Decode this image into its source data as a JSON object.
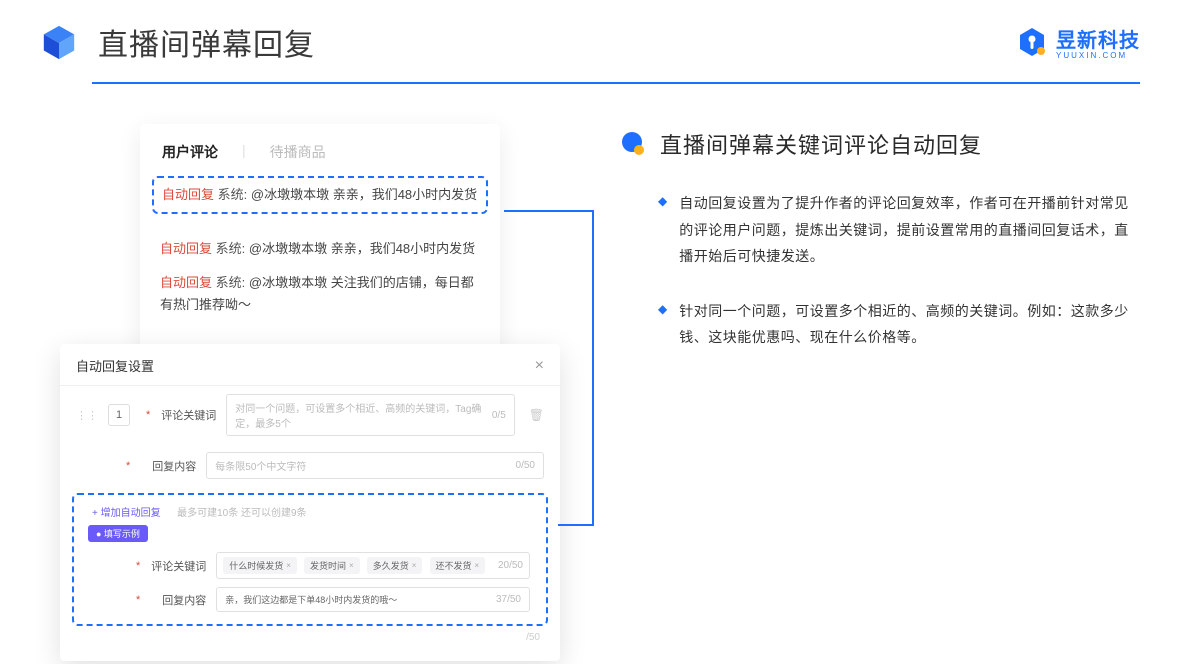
{
  "header": {
    "title": "直播间弹幕回复",
    "brand": "昱新科技",
    "brand_sub": "YUUXIN.COM"
  },
  "comments_panel": {
    "tab_active": "用户评论",
    "tab_inactive": "待播商品",
    "rows": [
      {
        "badge": "自动回复",
        "sys": "系统:",
        "text": "@冰墩墩本墩 亲亲，我们48小时内发货"
      },
      {
        "badge": "自动回复",
        "sys": "系统:",
        "text": "@冰墩墩本墩 亲亲，我们48小时内发货"
      },
      {
        "badge": "自动回复",
        "sys": "系统:",
        "text": "@冰墩墩本墩 关注我们的店铺，每日都有热门推荐呦～"
      }
    ]
  },
  "settings_panel": {
    "title": "自动回复设置",
    "num": "1",
    "kw_label": "评论关键词",
    "kw_placeholder": "对同一个问题，可设置多个相近、高频的关键词，Tag确定，最多5个",
    "kw_count": "0/5",
    "content_label": "回复内容",
    "content_placeholder": "每条限50个中文字符",
    "content_count": "0/50",
    "add_link": "+ 增加自动回复",
    "add_hint": "最多可建10条 还可以创建9条",
    "example_badge": "● 填写示例",
    "ex_kw_label": "评论关键词",
    "ex_tags": [
      "什么时候发货",
      "发货时间",
      "多久发货",
      "还不发货"
    ],
    "ex_kw_count": "20/50",
    "ex_content_label": "回复内容",
    "ex_content_value": "亲，我们这边都是下单48小时内发货的哦～",
    "ex_content_count": "37/50",
    "extra_count": "/50"
  },
  "right": {
    "section_title": "直播间弹幕关键词评论自动回复",
    "bullets": [
      "自动回复设置为了提升作者的评论回复效率，作者可在开播前针对常见的评论用户问题，提炼出关键词，提前设置常用的直播间回复话术，直播开始后可快捷发送。",
      "针对同一个问题，可设置多个相近的、高频的关键词。例如：这款多少钱、这块能优惠吗、现在什么价格等。"
    ]
  }
}
